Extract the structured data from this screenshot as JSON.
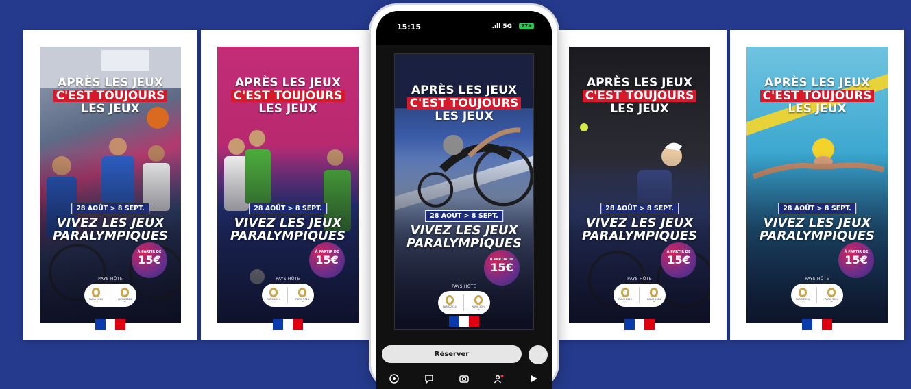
{
  "poster": {
    "headline_top": "APRÈS LES JEUX",
    "headline_mid": "C'EST TOUJOURS",
    "headline_bot": "LES JEUX",
    "dates": "28 AOÛT > 8 SEPT.",
    "tagline_1": "VIVEZ LES JEUX",
    "tagline_2": "PARALYMPIQUES",
    "price_from": "À PARTIR DE",
    "price": "15€",
    "host_label": "PAYS HÔTE",
    "logo_left": "PARIS 2024",
    "logo_right": "PARIS 2024"
  },
  "phone": {
    "time": "15:15",
    "signal": "5G",
    "battery": "77+",
    "cta": "Réserver"
  },
  "icons": [
    "location-icon",
    "chat-icon",
    "camera-icon",
    "friends-icon",
    "play-icon",
    "send-icon"
  ],
  "colors": {
    "background": "#253a8c",
    "accent_red": "#d7192c",
    "date_blue": "#1c2b7a",
    "flag_blue": "#0a3bad",
    "flag_red": "#e1000f"
  }
}
